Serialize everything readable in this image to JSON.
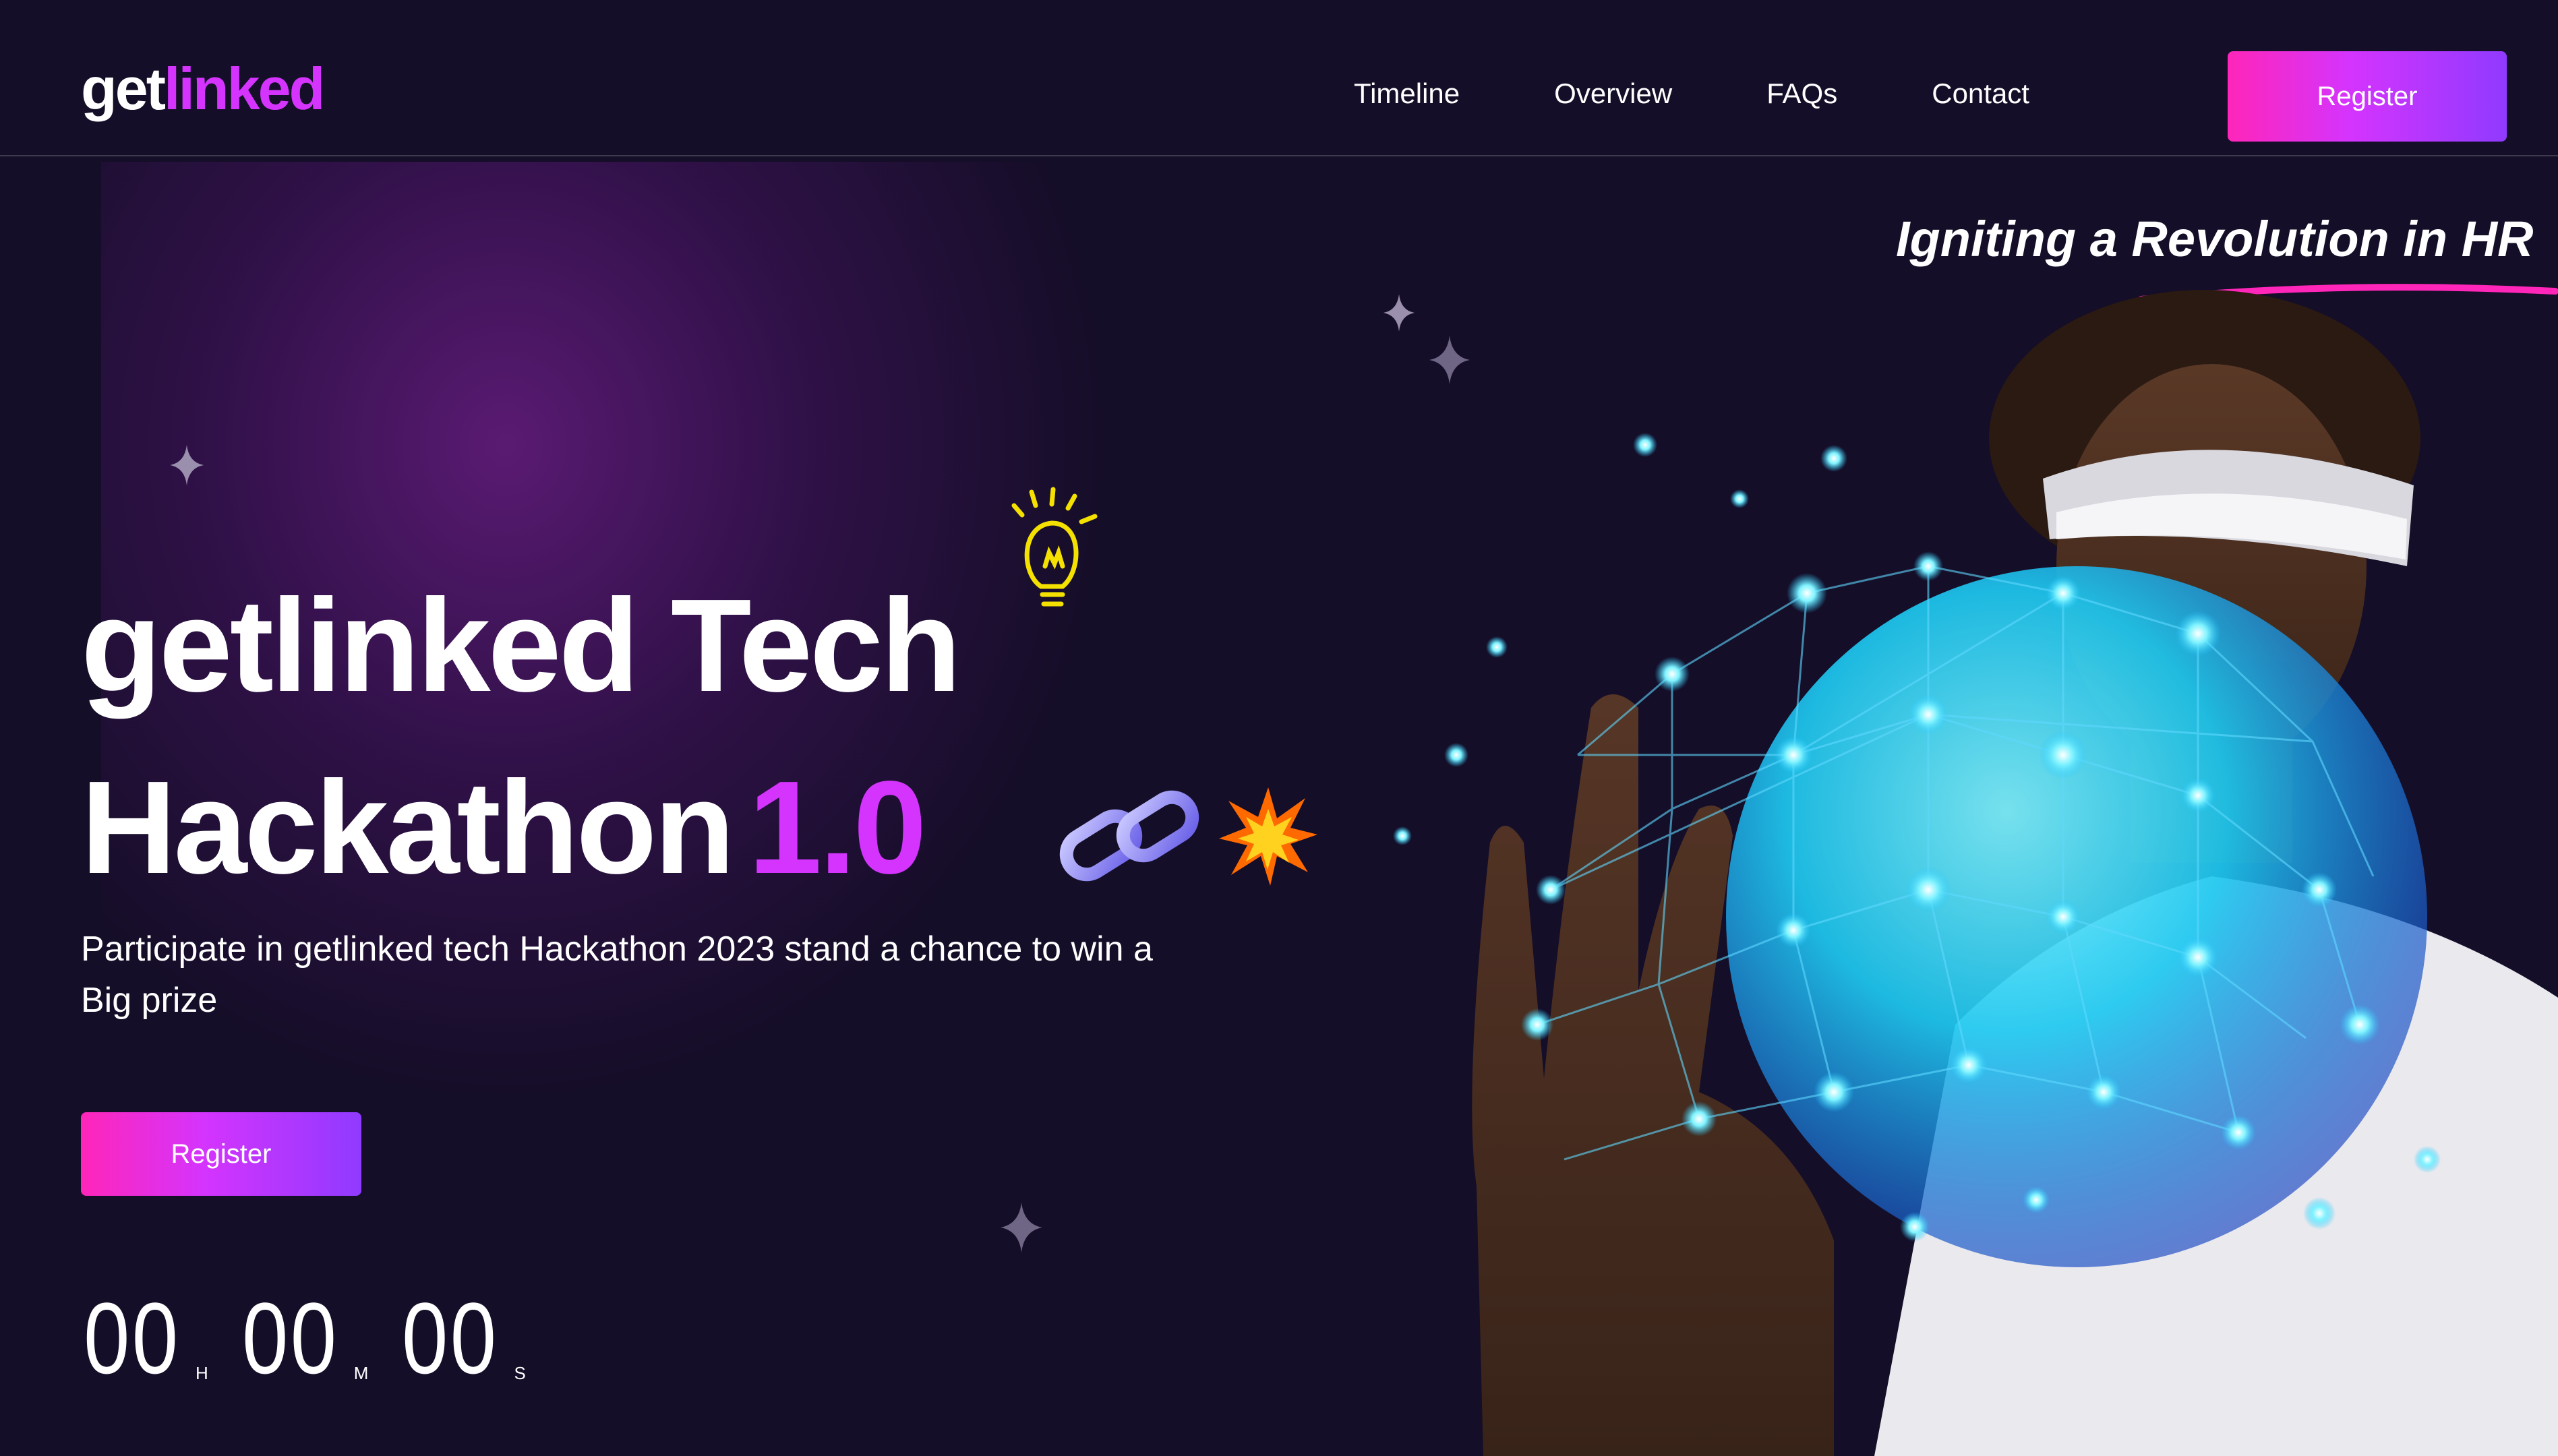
{
  "nav": {
    "logo_main": "get",
    "logo_accent": "linked",
    "links": [
      "Timeline",
      "Overview",
      "FAQs",
      "Contact"
    ],
    "register_label": "Register"
  },
  "tagline": "Igniting a Revolution in HR",
  "hero": {
    "title_line1": "getlinked Tech",
    "title_line2": "Hackathon",
    "title_version": "1.0",
    "description": "Participate in getlinked tech Hackathon 2023 stand a chance to win a Big prize",
    "register_label": "Register"
  },
  "countdown": {
    "hours": "00",
    "hours_label": "H",
    "minutes": "00",
    "minutes_label": "M",
    "seconds": "00",
    "seconds_label": "S"
  },
  "colors": {
    "background": "#150E28",
    "accent": "#D434FE",
    "gradient_start": "#FF26B9",
    "gradient_end": "#903AFF"
  },
  "icons": {
    "bulb": "lightbulb-icon",
    "chain": "chain-link-icon",
    "spark": "explosion-icon",
    "star": "sparkle-star-icon"
  }
}
